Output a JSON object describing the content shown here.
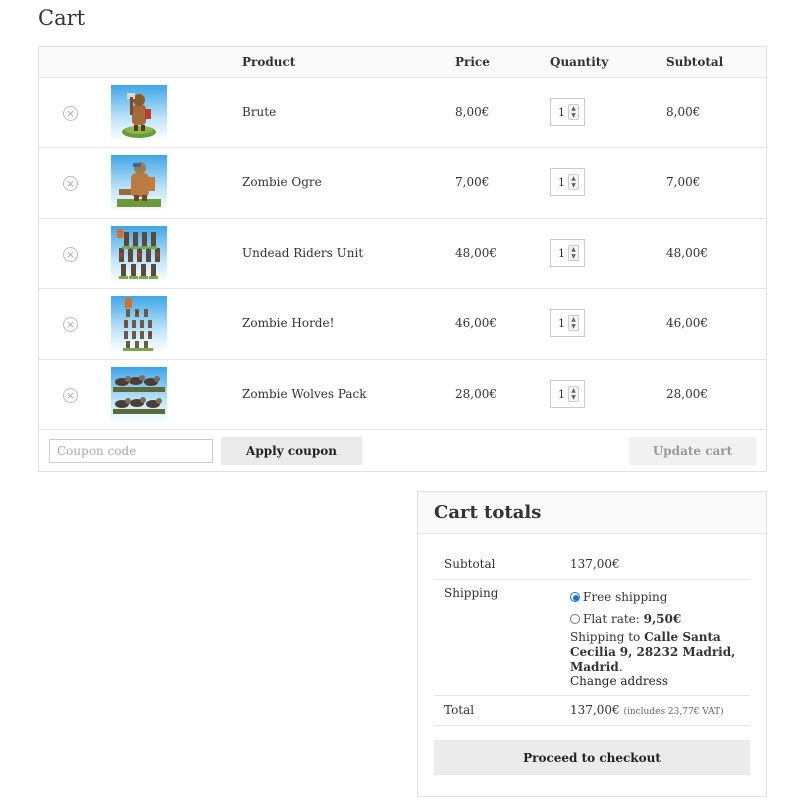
{
  "page": {
    "title": "Cart"
  },
  "table": {
    "headers": {
      "product": "Product",
      "price": "Price",
      "quantity": "Quantity",
      "subtotal": "Subtotal"
    },
    "remove_symbol": "×",
    "rows": [
      {
        "name": "Brute",
        "price": "8,00€",
        "qty": "1",
        "subtotal": "8,00€",
        "thumb_icon": "orc-brute-miniature"
      },
      {
        "name": "Zombie Ogre",
        "price": "7,00€",
        "qty": "1",
        "subtotal": "7,00€",
        "thumb_icon": "zombie-ogre-miniature"
      },
      {
        "name": "Undead Riders Unit",
        "price": "48,00€",
        "qty": "1",
        "subtotal": "48,00€",
        "thumb_icon": "undead-riders-miniatures"
      },
      {
        "name": "Zombie Horde!",
        "price": "46,00€",
        "qty": "1",
        "subtotal": "46,00€",
        "thumb_icon": "zombie-horde-miniatures"
      },
      {
        "name": "Zombie Wolves Pack",
        "price": "28,00€",
        "qty": "1",
        "subtotal": "28,00€",
        "thumb_icon": "zombie-wolves-miniatures"
      }
    ]
  },
  "actions": {
    "coupon_placeholder": "Coupon code",
    "apply_label": "Apply coupon",
    "update_label": "Update cart"
  },
  "totals": {
    "title": "Cart totals",
    "subtotal_label": "Subtotal",
    "subtotal_value": "137,00€",
    "shipping_label": "Shipping",
    "free_shipping": "Free shipping",
    "flat_rate_label": "Flat rate:",
    "flat_rate_value": "9,50€",
    "shipping_to_prefix": "Shipping to",
    "address_line1": "Calle Santa Cecilia",
    "address_line2": "9, 28232 Madrid, Madrid",
    "address_suffix": ".",
    "change_address": "Change address",
    "total_label": "Total",
    "total_value": "137,00€",
    "vat_note": "(includes 23,77€ VAT)",
    "checkout_label": "Proceed to checkout"
  },
  "colors": {
    "accent_radio": "#1a73e8",
    "button_bg": "#ebebeb",
    "header_bg": "#fafafa",
    "border": "#e1e1e1"
  }
}
